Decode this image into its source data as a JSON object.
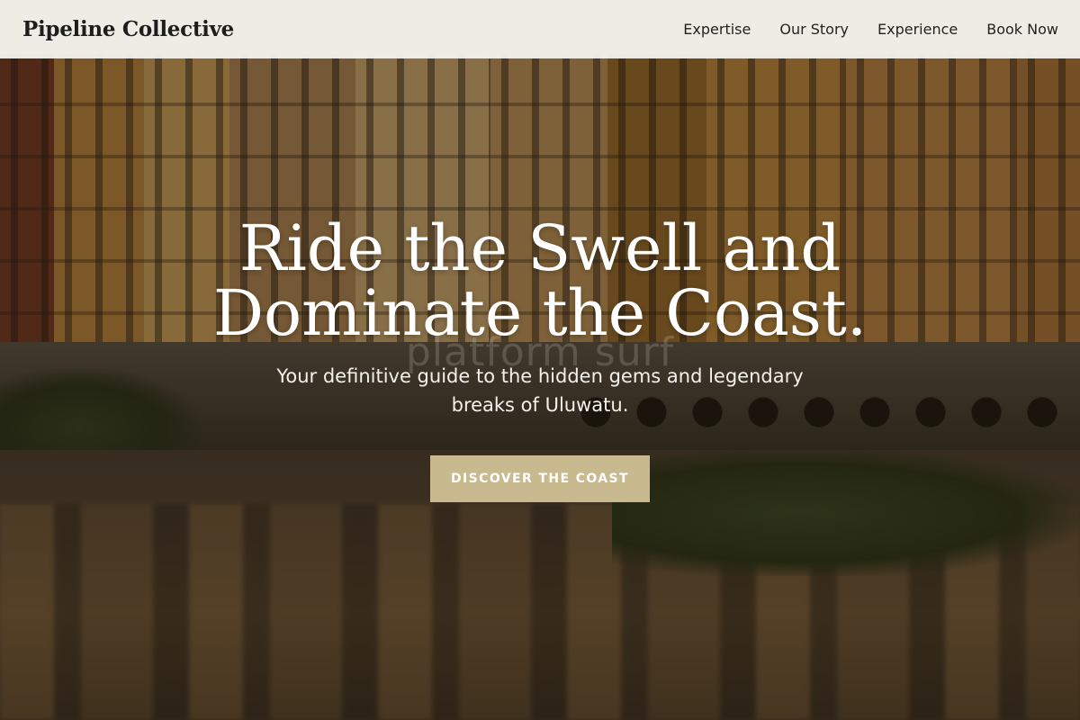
{
  "header": {
    "brand": "Pipeline Collective",
    "nav": [
      {
        "label": "Expertise"
      },
      {
        "label": "Our Story"
      },
      {
        "label": "Experience"
      },
      {
        "label": "Book Now"
      }
    ]
  },
  "hero": {
    "headline_line1": "Ride the Swell and",
    "headline_line2": "Dominate the Coast.",
    "watermark": "platform surf",
    "subhead": "Your definitive guide to the hidden gems and legendary breaks of Uluwatu.",
    "cta_label": "DISCOVER THE COAST",
    "background_description_icon": "riverside-buildings-photo"
  },
  "colors": {
    "header_bg": "#f6f4f0",
    "cta_bg": "#c9b98f",
    "text_light": "#ffffff"
  }
}
